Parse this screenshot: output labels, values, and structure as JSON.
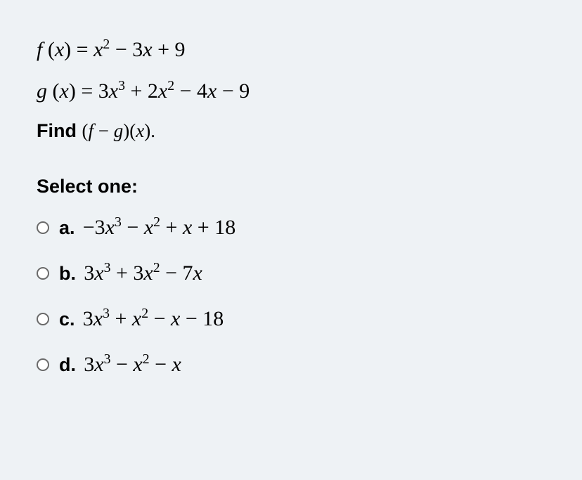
{
  "question": {
    "f_def_html": "<span class='ital'>f</span> (<span class='ital'>x</span>) = <span class='ital'>x</span><sup>2</sup> − 3<span class='ital'>x</span> + 9",
    "g_def_html": "<span class='ital'>g</span> (<span class='ital'>x</span>) = 3<span class='ital'>x</span><sup>3</sup> + 2<span class='ital'>x</span><sup>2</sup> − 4<span class='ital'>x</span> − 9",
    "find_prefix": "Find ",
    "find_math_html": "(<span class='ital'>f</span> − <span class='ital'>g</span>)(<span class='ital'>x</span>).",
    "select_label": "Select one:"
  },
  "options": [
    {
      "label": "a.",
      "math_html": "−3<span class='ital'>x</span><sup>3</sup> − <span class='ital'>x</span><sup>2</sup> + <span class='ital'>x</span> + 18"
    },
    {
      "label": "b.",
      "math_html": "3<span class='ital'>x</span><sup>3</sup> + 3<span class='ital'>x</span><sup>2</sup> − 7<span class='ital'>x</span>"
    },
    {
      "label": "c.",
      "math_html": "3<span class='ital'>x</span><sup>3</sup> + <span class='ital'>x</span><sup>2</sup> − <span class='ital'>x</span> − 18"
    },
    {
      "label": "d.",
      "math_html": "3<span class='ital'>x</span><sup>3</sup> − <span class='ital'>x</span><sup>2</sup> − <span class='ital'>x</span>"
    }
  ]
}
